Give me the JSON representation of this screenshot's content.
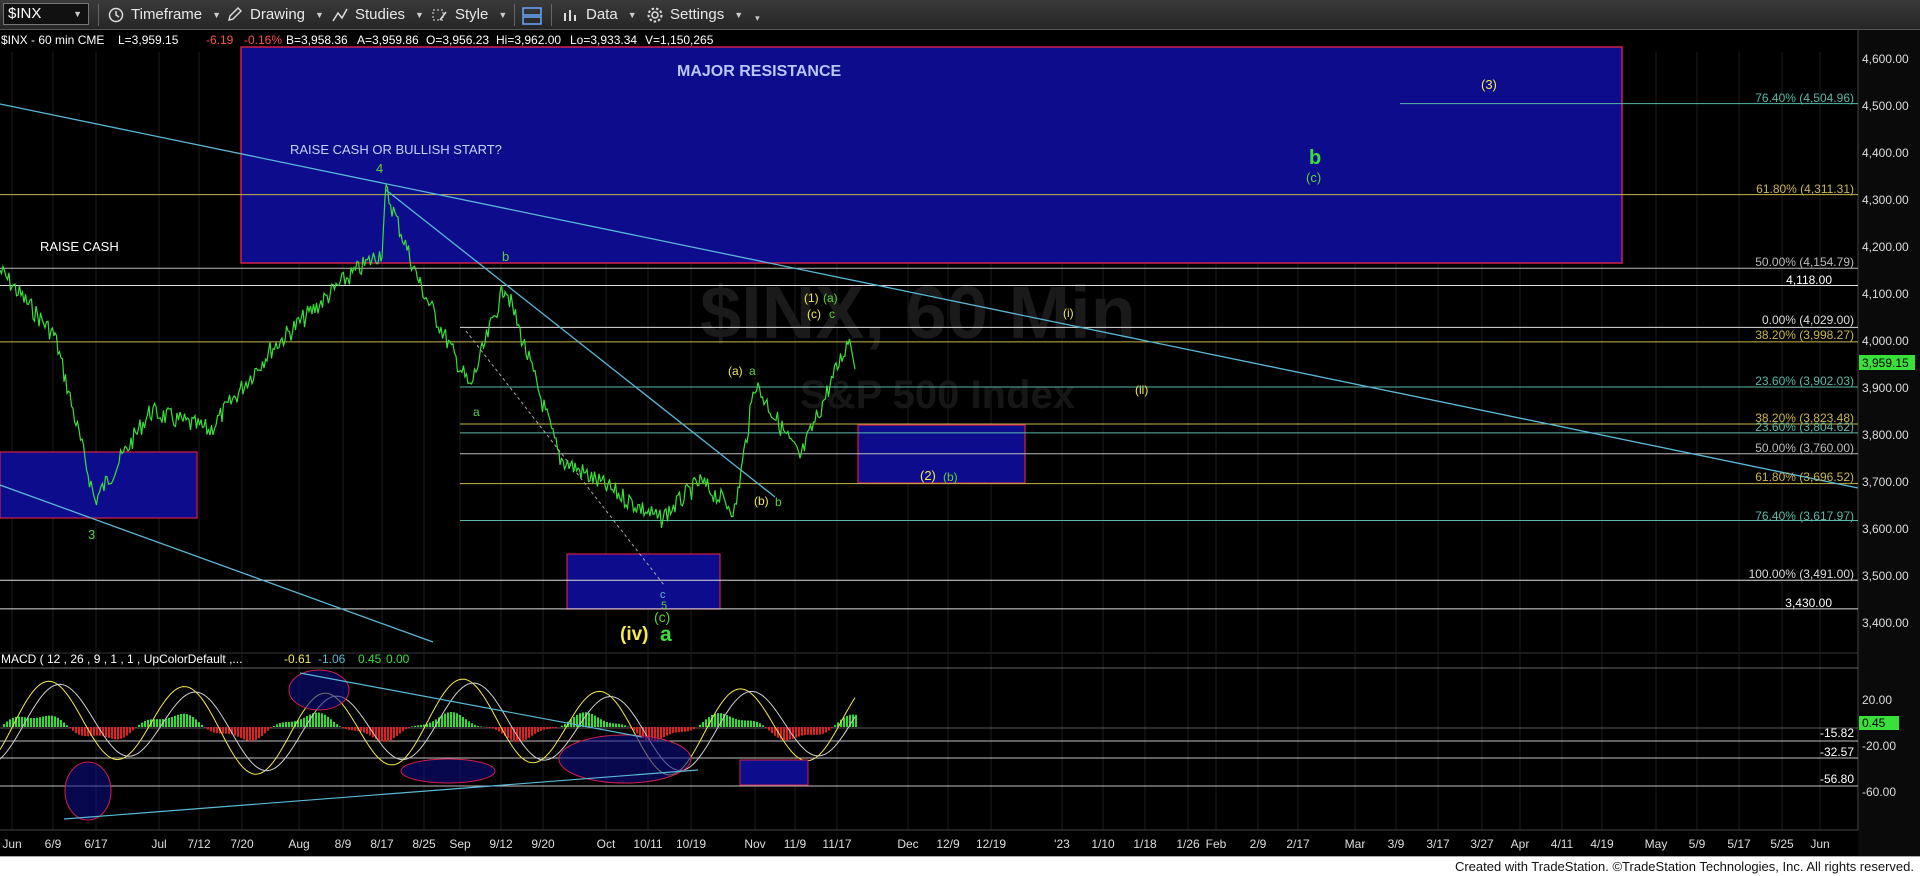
{
  "toolbar": {
    "symbol": "$INX",
    "timeframe": "Timeframe",
    "drawing": "Drawing",
    "studies": "Studies",
    "style": "Style",
    "data": "Data",
    "settings": "Settings"
  },
  "header": {
    "title": "$INX - 60 min  CME",
    "last": "L=3,959.15",
    "change": "-6.19",
    "pct": "-0.16%",
    "bid": "B=3,958.36",
    "ask": "A=3,959.86",
    "open": "O=3,956.23",
    "high": "Hi=3,962.00",
    "low": "Lo=3,933.34",
    "volume": "V=1,150,265"
  },
  "watermark": {
    "line1": "$INX, 60 Min",
    "line2": "S&P 500 Index"
  },
  "annotations": {
    "major_resistance": "MAJOR RESISTANCE",
    "raise_cash_or_bullish": "RAISE CASH OR BULLISH START?",
    "raise_cash": "RAISE CASH",
    "w4": "4",
    "w3": "3",
    "b_small": "b",
    "a_small": "a",
    "c_small": "c",
    "five": "5",
    "iv": "(iv)",
    "a_big": "a",
    "c_paren": "(c)",
    "one_a": "(1)",
    "a_paren_green": "(a)",
    "c_paren_y": "(c)",
    "c_g": "c",
    "a_paren_y": "(a)",
    "a_g2": "a",
    "b_paren_y": "(b)",
    "b_g2": "b",
    "i_roman": "(i)",
    "ii_roman": "(ii)",
    "two": "(2)",
    "b_paren_green": "(b)",
    "three": "(3)",
    "big_b": "b",
    "c_paren_green": "(c)"
  },
  "fib_labels": {
    "f7640_top": "76.40% (4,504.96)",
    "f6180_top": "61.80% (4,311.31)",
    "f5000_top": "50.00% (4,154.79)",
    "l4118": "4,118.00",
    "f0": "0.00% (4,029.00)",
    "f382": "38.20% (3,998.27)",
    "f236": "23.60% (3,902.03)",
    "f382b": "38.20% (3,823.48)",
    "f236b": "23.60% (3,804.62)",
    "f50": "50.00% (3,760.00)",
    "f618": "61.80% (3,696.52)",
    "f764": "76.40% (3,617.97)",
    "f100a": "100.00% (3,491.00)",
    "l3430": "3,430.00",
    "price_tag": "3,959.15"
  },
  "price_axis": [
    "4,600.00",
    "4,500.00",
    "4,400.00",
    "4,300.00",
    "4,200.00",
    "4,100.00",
    "4,000.00",
    "3,900.00",
    "3,800.00",
    "3,700.00",
    "3,600.00",
    "3,500.00",
    "3,400.00"
  ],
  "macd": {
    "header": "MACD ( 12 , 26 , 9 , 1 , 1 , UpColorDefault ,...",
    "v1": "-0.61",
    "v2": "-1.06",
    "v3": "0.45",
    "v4": "0.00",
    "axis": [
      "20.00",
      "-20.00",
      "-60.00"
    ],
    "lines": [
      "-15.82",
      "-32.57",
      "-56.80"
    ],
    "tag": "0.45"
  },
  "time_axis": [
    "Jun",
    "6/9",
    "6/17",
    "Jul",
    "7/12",
    "7/20",
    "Aug",
    "8/9",
    "8/17",
    "8/25",
    "Sep",
    "9/12",
    "9/20",
    "Oct",
    "10/11",
    "10/19",
    "Nov",
    "11/9",
    "11/17",
    "Dec",
    "12/9",
    "12/19",
    "'23",
    "1/10",
    "1/18",
    "1/26",
    "Feb",
    "2/9",
    "2/17",
    "Mar",
    "3/9",
    "3/17",
    "3/27",
    "Apr",
    "4/11",
    "4/19",
    "May",
    "5/9",
    "5/17",
    "5/25",
    "Jun"
  ],
  "footer": "Created with TradeStation. ©TradeStation Technologies, Inc. All rights reserved.",
  "colors": {
    "resistance_box": "#0c0c8c",
    "box_border": "#d0204a",
    "green_label": "#5ad13a",
    "yellow_label": "#f2ea4a",
    "trendline": "#5ab8d6",
    "price_bar": "#3ae03a"
  },
  "chart_data": {
    "type": "line",
    "title": "$INX - 60 min",
    "ylim": [
      3370,
      4640
    ],
    "x": [
      "Jun",
      "6/9",
      "6/17",
      "Jul",
      "7/12",
      "7/20",
      "Aug",
      "8/9",
      "8/17",
      "8/25",
      "Sep",
      "9/12",
      "9/20",
      "Oct",
      "10/11",
      "10/19",
      "Nov",
      "11/9",
      "11/17"
    ],
    "series": [
      {
        "values": [
          4150,
          4010,
          3660,
          3850,
          3810,
          3980,
          4130,
          4190,
          4320,
          4120,
          3900,
          4120,
          3750,
          3620,
          3700,
          3640,
          3910,
          3750,
          4010
        ]
      }
    ],
    "fib_levels": [
      4504.96,
      4311.31,
      4154.79,
      4118.0,
      4029.0,
      3998.27,
      3902.03,
      3823.48,
      3804.62,
      3760.0,
      3696.52,
      3617.97,
      3491.0,
      3430.0
    ],
    "last": 3959.15
  }
}
